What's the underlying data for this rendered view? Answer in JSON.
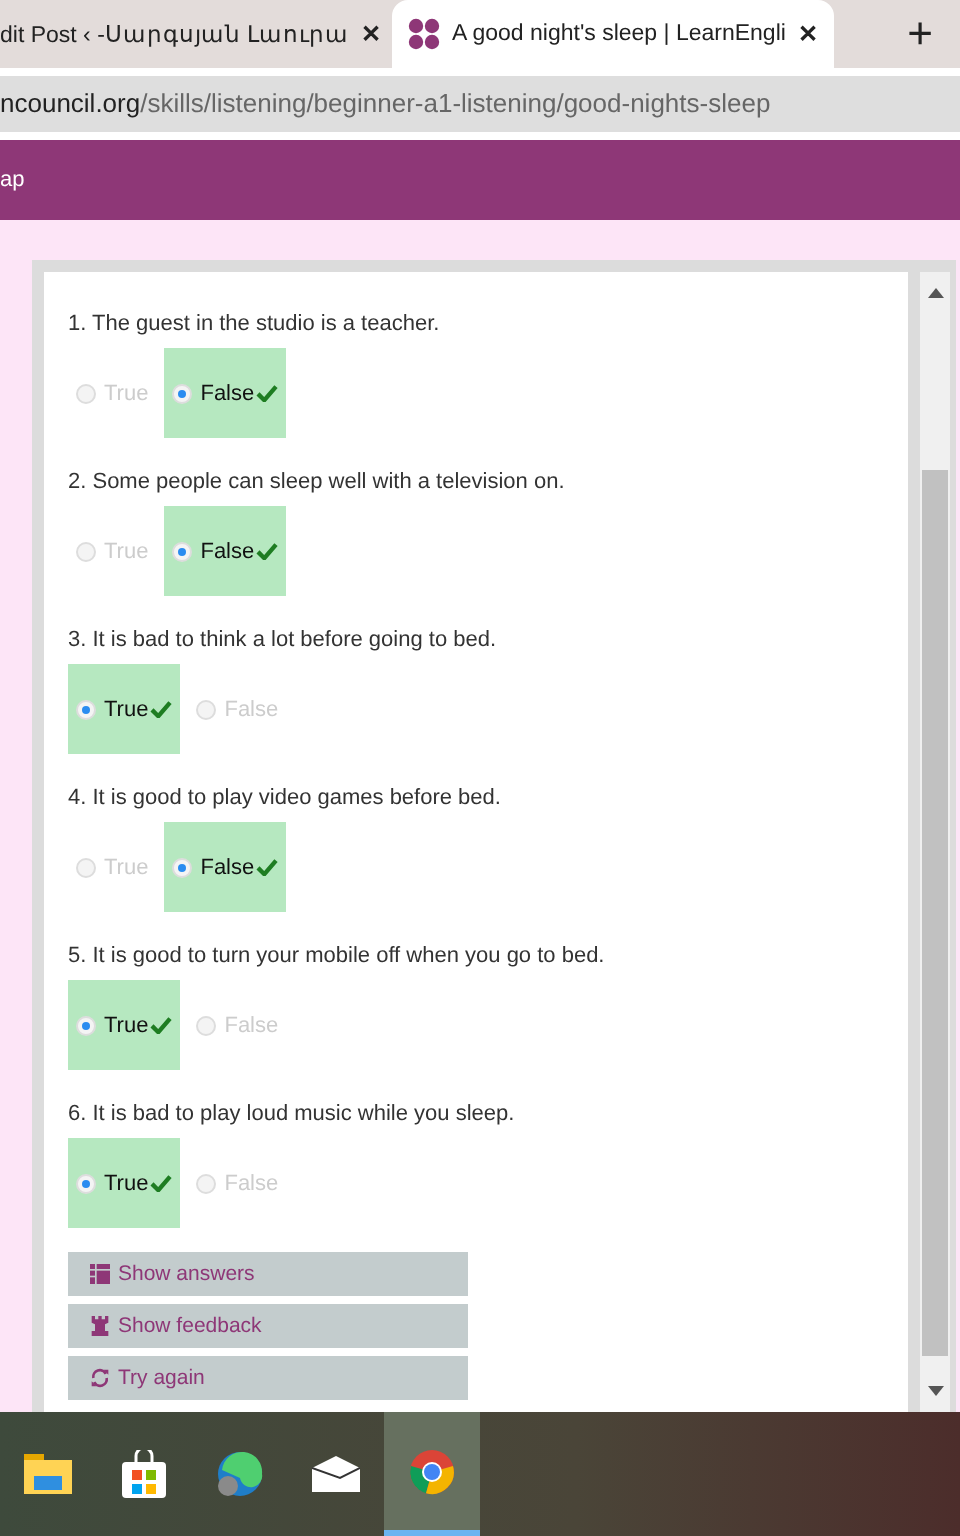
{
  "browser": {
    "tabs": [
      {
        "title": "dit Post ‹ -Սարգսյան Լաուրա",
        "close": "✕",
        "selected": false,
        "kind": "plain"
      },
      {
        "title": "A good night's sleep | LearnEngli",
        "close": "✕",
        "selected": true,
        "kind": "site"
      }
    ],
    "new_tab": "+",
    "url": {
      "host": "ncouncil.org",
      "path": "/skills/listening/beginner-a1-listening/good-nights-sleep"
    }
  },
  "site_bar": {
    "text": "ap"
  },
  "questions": [
    {
      "text": "1. The guest in the studio is a teacher.",
      "options": [
        {
          "label": "True",
          "selected": false
        },
        {
          "label": "False",
          "selected": true
        }
      ]
    },
    {
      "text": "2. Some people can sleep well with a television on.",
      "options": [
        {
          "label": "True",
          "selected": false
        },
        {
          "label": "False",
          "selected": true
        }
      ]
    },
    {
      "text": "3. It is bad to think a lot before going to bed.",
      "options": [
        {
          "label": "True",
          "selected": true
        },
        {
          "label": "False",
          "selected": false
        }
      ]
    },
    {
      "text": "4. It is good to play video games before bed.",
      "options": [
        {
          "label": "True",
          "selected": false
        },
        {
          "label": "False",
          "selected": true
        }
      ]
    },
    {
      "text": "5. It is good to turn your mobile off when you go to bed.",
      "options": [
        {
          "label": "True",
          "selected": true
        },
        {
          "label": "False",
          "selected": false
        }
      ]
    },
    {
      "text": "6. It is bad to play loud music while you sleep.",
      "options": [
        {
          "label": "True",
          "selected": true
        },
        {
          "label": "False",
          "selected": false
        }
      ]
    }
  ],
  "actions": [
    {
      "label": "Show answers",
      "kind": "answers"
    },
    {
      "label": "Show feedback",
      "kind": "feedback"
    },
    {
      "label": "Try again",
      "kind": "retry"
    }
  ],
  "taskbar": [
    {
      "kind": "folder",
      "selected": false
    },
    {
      "kind": "store",
      "selected": false
    },
    {
      "kind": "edge",
      "selected": false
    },
    {
      "kind": "mail",
      "selected": false
    },
    {
      "kind": "chrome",
      "selected": true
    }
  ]
}
